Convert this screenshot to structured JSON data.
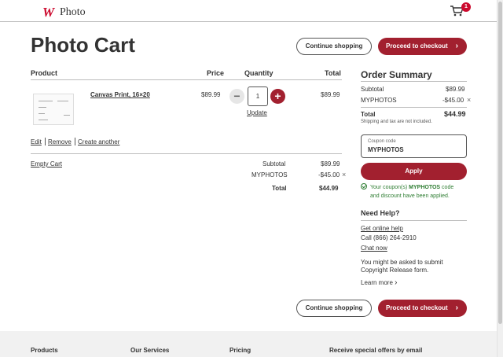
{
  "header": {
    "logo_mark": "W",
    "logo_text": "Photo",
    "cart_icon": "cart-icon",
    "cart_count": "1"
  },
  "page": {
    "title": "Photo Cart",
    "continue_label": "Continue shopping",
    "checkout_label": "Proceed to checkout",
    "chevron": "›"
  },
  "table": {
    "headers": {
      "product": "Product",
      "price": "Price",
      "quantity": "Quantity",
      "total": "Total"
    },
    "item": {
      "name": "Canvas Print, 16×20",
      "price": "$89.99",
      "quantity": "1",
      "total": "$89.99",
      "update": "Update",
      "minus": "−",
      "plus": "+"
    },
    "actions": {
      "edit": "Edit",
      "remove": "Remove",
      "create_another": "Create another"
    },
    "empty_cart": "Empty Cart",
    "summary": {
      "subtotal_label": "Subtotal",
      "subtotal_value": "$89.99",
      "coupon_label": "MYPHOTOS",
      "coupon_value": "-$45.00",
      "total_label": "Total",
      "total_value": "$44.99"
    }
  },
  "order_summary": {
    "title": "Order Summary",
    "subtotal_label": "Subtotal",
    "subtotal_value": "$89.99",
    "coupon_label": "MYPHOTOS",
    "coupon_value": "-$45.00",
    "remove_x": "×",
    "total_label": "Total",
    "total_value": "$44.99",
    "shipping_note": "Shipping and tax are not included.",
    "coupon_field_label": "Coupon code",
    "coupon_field_value": "MYPHOTOS",
    "apply_label": "Apply",
    "success_pre": "Your coupon(s) ",
    "success_code": "MYPHOTOS",
    "success_post": " code",
    "success_line2": "and discount have been applied."
  },
  "help": {
    "title": "Need Help?",
    "online_help": "Get online help",
    "call": "Call (866) 264-2910",
    "chat": "Chat now",
    "note_line1": "You might be asked to submit",
    "note_line2": "Copyright Release form.",
    "learn_more": "Learn more"
  },
  "footer": {
    "products": "Products",
    "services": "Our Services",
    "pricing": "Pricing",
    "offers": "Receive special offers by email"
  },
  "colors": {
    "brand_red": "#cc0a2e",
    "button_red": "#a2202f",
    "success_green": "#2e7d32"
  }
}
